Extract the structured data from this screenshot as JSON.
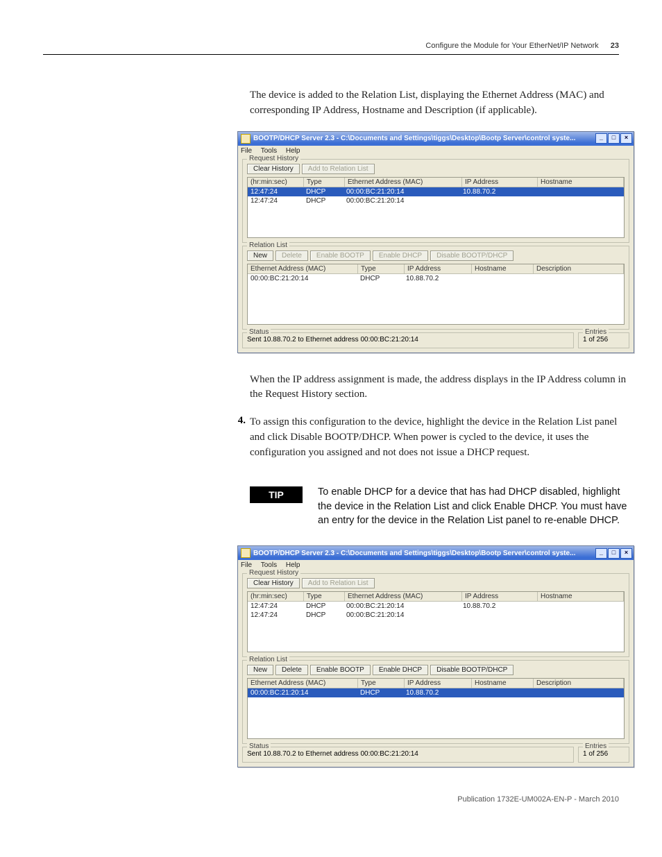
{
  "header": {
    "running_title": "Configure the Module for Your EtherNet/IP Network",
    "page_number": "23"
  },
  "paragraphs": {
    "p1": "The device is added to the Relation List, displaying the Ethernet Address (MAC) and corresponding IP Address, Hostname and Description (if applicable).",
    "p2": "When the IP address assignment is made, the address displays in the IP Address column in the Request History section.",
    "step4_num": "4.",
    "step4": "To assign this configuration to the device, highlight the device in the Relation List panel and click Disable BOOTP/DHCP. When power is cycled to the device, it uses the configuration you assigned and not does not issue a DHCP request."
  },
  "tip": {
    "label": "TIP",
    "text": "To enable DHCP for a device that has had DHCP disabled, highlight the device in the Relation List and click Enable DHCP. You must have an entry for the device in the Relation List panel to re-enable DHCP."
  },
  "footer": {
    "pub": "Publication 1732E-UM002A-EN-P - March 2010"
  },
  "window_common": {
    "title": "BOOTP/DHCP Server 2.3 - C:\\Documents and Settings\\tiggs\\Desktop\\Bootp Server\\control syste...",
    "min": "_",
    "max": "□",
    "close": "×",
    "menu": {
      "file": "File",
      "tools": "Tools",
      "help": "Help"
    },
    "request_history_label": "Request History",
    "relation_list_label": "Relation List",
    "status_label": "Status",
    "entries_label": "Entries",
    "buttons": {
      "clear_history": "Clear History",
      "add_to_relation": "Add to Relation List",
      "new": "New",
      "delete": "Delete",
      "enable_bootp": "Enable BOOTP",
      "enable_dhcp": "Enable DHCP",
      "disable_bootp_dhcp": "Disable BOOTP/DHCP"
    },
    "rh_headers": {
      "time": "(hr:min:sec)",
      "type": "Type",
      "mac": "Ethernet Address (MAC)",
      "ip": "IP Address",
      "host": "Hostname"
    },
    "rl_headers": {
      "mac": "Ethernet Address (MAC)",
      "type": "Type",
      "ip": "IP Address",
      "host": "Hostname",
      "desc": "Description"
    },
    "status_text": "Sent 10.88.70.2 to Ethernet address 00:00:BC:21:20:14",
    "entries_text": "1 of 256"
  },
  "window1": {
    "rh_rows": [
      {
        "time": "12:47:24",
        "type": "DHCP",
        "mac": "00:00:BC:21:20:14",
        "ip": "10.88.70.2",
        "host": ""
      },
      {
        "time": "12:47:24",
        "type": "DHCP",
        "mac": "00:00:BC:21:20:14",
        "ip": "",
        "host": ""
      }
    ],
    "rh_selected_index": 0,
    "rl_rows": [
      {
        "mac": "00:00:BC:21:20:14",
        "type": "DHCP",
        "ip": "10.88.70.2",
        "host": "",
        "desc": ""
      }
    ],
    "rl_selected_index": -1,
    "rl_buttons_disabled": true
  },
  "window2": {
    "rh_rows": [
      {
        "time": "12:47:24",
        "type": "DHCP",
        "mac": "00:00:BC:21:20:14",
        "ip": "10.88.70.2",
        "host": ""
      },
      {
        "time": "12:47:24",
        "type": "DHCP",
        "mac": "00:00:BC:21:20:14",
        "ip": "",
        "host": ""
      }
    ],
    "rh_selected_index": -1,
    "rl_rows": [
      {
        "mac": "00:00:BC:21:20:14",
        "type": "DHCP",
        "ip": "10.88.70.2",
        "host": "",
        "desc": ""
      }
    ],
    "rl_selected_index": 0,
    "rl_buttons_disabled": false
  }
}
